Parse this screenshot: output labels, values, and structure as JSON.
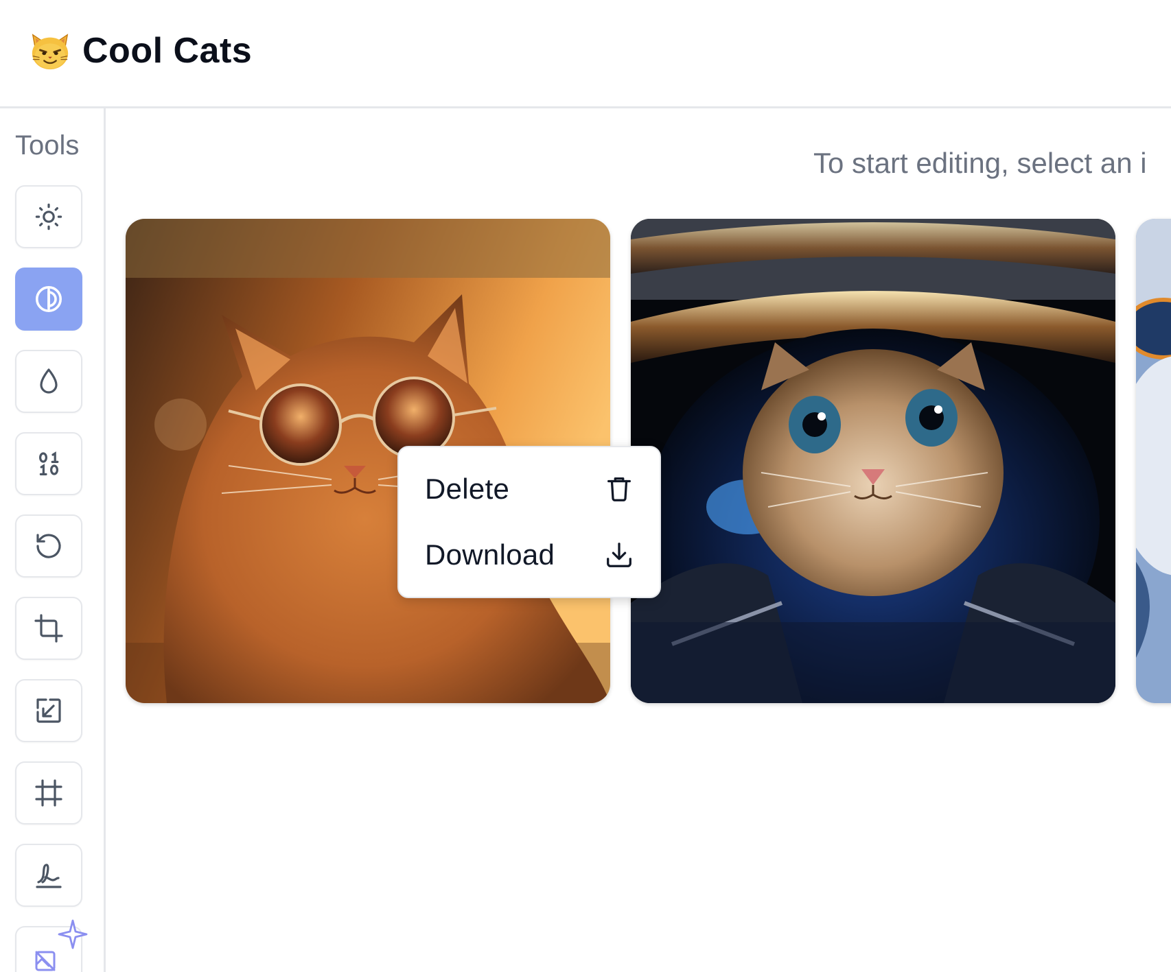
{
  "header": {
    "title": "Cool Cats",
    "logo_icon": "cat-emoji-icon"
  },
  "sidebar": {
    "title": "Tools",
    "tools": [
      {
        "name": "brightness",
        "icon": "sun-icon",
        "active": false
      },
      {
        "name": "contrast",
        "icon": "contrast-icon",
        "active": true
      },
      {
        "name": "saturation",
        "icon": "droplet-icon",
        "active": false
      },
      {
        "name": "binary",
        "icon": "binary-icon",
        "active": false
      },
      {
        "name": "rotate",
        "icon": "rotate-ccw-icon",
        "active": false
      },
      {
        "name": "crop",
        "icon": "crop-icon",
        "active": false
      },
      {
        "name": "resize",
        "icon": "resize-icon",
        "active": false
      },
      {
        "name": "frame",
        "icon": "frame-icon",
        "active": false
      },
      {
        "name": "signature",
        "icon": "signature-icon",
        "active": false
      },
      {
        "name": "remove-background",
        "icon": "image-off-sparkle-icon",
        "active": false
      }
    ]
  },
  "main": {
    "hint": "To start editing, select an i",
    "images": [
      {
        "subject": "orange cat wearing sunglasses"
      },
      {
        "subject": "cat in astronaut helmet"
      },
      {
        "subject": "white cat"
      }
    ]
  },
  "context_menu": {
    "items": [
      {
        "label": "Delete",
        "icon": "trash-icon"
      },
      {
        "label": "Download",
        "icon": "download-icon"
      }
    ]
  },
  "colors": {
    "active_tool": "#8aa3f2",
    "border": "#e5e7eb",
    "muted_text": "#6b7280"
  }
}
